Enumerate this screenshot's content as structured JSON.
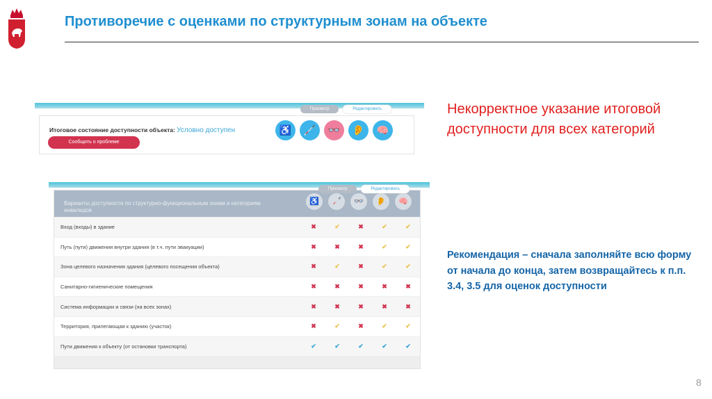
{
  "header": {
    "title": "Противоречие с оценками по структурным зонам на объекте"
  },
  "shot1": {
    "tabs": [
      "Просмотр",
      "Редактировать"
    ],
    "status_label": "Итоговое состояние доступности объекта: ",
    "status_value": "Условно доступен",
    "report_button": "Сообщить о проблеме",
    "icons": [
      {
        "name": "wheelchair-icon",
        "glyph": "♿",
        "color": "#3db5ea"
      },
      {
        "name": "cane-icon",
        "glyph": "🦯",
        "color": "#3db5ea"
      },
      {
        "name": "glasses-icon",
        "glyph": "👓",
        "color": "#ef7d9c"
      },
      {
        "name": "ear-icon",
        "glyph": "👂",
        "color": "#3db5ea"
      },
      {
        "name": "head-icon",
        "glyph": "🧠",
        "color": "#3db5ea"
      }
    ]
  },
  "shot2": {
    "tabs": [
      "Просмотр",
      "Редактировать"
    ],
    "header": "Варианты доступности по структурно-функциональным зонам и категориям инвалидов",
    "rows": [
      {
        "name": "Вход (входы) в здание",
        "marks": [
          "x",
          "y",
          "x",
          "y",
          "y"
        ]
      },
      {
        "name": "Путь (пути) движения внутри здания (в т.ч. пути эвакуации)",
        "marks": [
          "x",
          "x",
          "x",
          "y",
          "y"
        ]
      },
      {
        "name": "Зона целевого назначения здания (целевого посещения объекта)",
        "marks": [
          "x",
          "y",
          "x",
          "y",
          "y"
        ]
      },
      {
        "name": "Санитарно-гигиенические помещения",
        "marks": [
          "x",
          "x",
          "x",
          "x",
          "x"
        ]
      },
      {
        "name": "Система информации и связи (на всех зонах)",
        "marks": [
          "x",
          "x",
          "x",
          "x",
          "x"
        ]
      },
      {
        "name": "Территория, прилегающая к зданию (участок)",
        "marks": [
          "x",
          "y",
          "x",
          "y",
          "y"
        ]
      },
      {
        "name": "Пути движения к объекту (от остановки транспорта)",
        "marks": [
          "b",
          "b",
          "b",
          "b",
          "b"
        ]
      }
    ]
  },
  "notes": {
    "red": "Некорректное указание итоговой доступности для всех категорий",
    "blue": "Рекомендация – сначала заполняйте всю форму от начала до конца, затем возвращайтесь к п.п. 3.4, 3.5 для оценок доступности"
  },
  "page_number": "8"
}
